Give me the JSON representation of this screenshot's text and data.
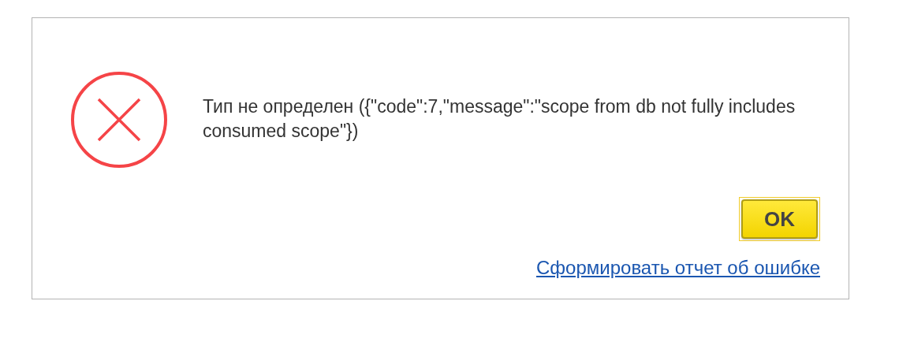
{
  "dialog": {
    "kind": "error",
    "message": "Тип не определен ({\"code\":7,\"message\":\"scope from db not fully includes consumed scope\"})",
    "button": {
      "label": "OK",
      "focused": true
    },
    "link": "Сформировать отчет об ошибке"
  }
}
